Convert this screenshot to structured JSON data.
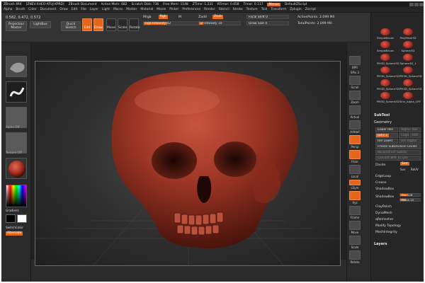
{
  "titlebar": {
    "app": "ZBrush 4R4",
    "file": "[ZNEV-XHEO-ATUJ-XPRD]",
    "doc": "ZBrush Document",
    "active_mem": "Active Mem: 682",
    "scratch": "Scratch Disk: 736",
    "free_mem": "Free Mem: 1148",
    "ztime": "ZTime: 1.231",
    "rtimer": "RTimer: 0.458",
    "timer": "Timer: 0.117",
    "menus_label": "Menus",
    "script": "DefaultZScript"
  },
  "menubar": [
    "Alpha",
    "Brush",
    "Color",
    "Document",
    "Draw",
    "Edit",
    "File",
    "Layer",
    "Light",
    "Macro",
    "Marker",
    "Material",
    "Movie",
    "Picker",
    "Preferences",
    "Render",
    "Stencil",
    "Stroke",
    "Texture",
    "Tool",
    "Transform",
    "Zplugin",
    "Zscript"
  ],
  "toolbar": {
    "coords": "0.582, 0.472, 0.572",
    "projection_master": "Projection Master",
    "lightbox": "LightBox",
    "quick_sketch": "Quick Sketch",
    "edit": "Edit",
    "draw": "Draw",
    "move": "Move",
    "scale": "Scale",
    "rotate": "Rotate",
    "mrgb": "Mrgb",
    "rgb": "Rgb",
    "m": "M",
    "rgb_intensity": "Rgb Intensity 42",
    "rgb_intensity_value": 42,
    "zadd": "Zadd",
    "zsub": "Zsub",
    "z_intensity": "Z Intensity 10",
    "z_intensity_value": 10,
    "focal_shift": "Focal Shift 0",
    "draw_size": "Draw Size 4",
    "active_points": "ActivePoints: 2.099 Mil",
    "total_points": "TotalPoints: 2.099 Mil"
  },
  "leftshelf": {
    "alpha_off": "Alpha Off",
    "texture_off": "Texture Off",
    "gradient": "Gradient",
    "switch_color": "SwitchColor",
    "alternate": "Alternate"
  },
  "rightstrip": [
    "BPR",
    "SPix 3",
    "Scroll",
    "Zoom",
    "Actual",
    "AAHalf",
    "Persp",
    "Floor",
    "Local",
    "LSym",
    "Xyz",
    "Frame",
    "Move",
    "Scale",
    "Rotate"
  ],
  "palette": {
    "tools": [
      "SimpleBrush",
      "PolyMesh3D",
      "SimpleBrush",
      "Sphere3D",
      "PM3D_Sphere3D",
      "Sphere3D_1",
      "PM3D_Sphere3D",
      "PM3D_Sphere3D",
      "PM3D_Sphere3D",
      "PM3D_Sphere3D",
      "PM3D_Sphere3D",
      "Skin_Alpha_OFF"
    ],
    "subtool": "SubTool",
    "geometry": "Geometry",
    "lower_res": "Lower Res",
    "higher_res": "Higher Res",
    "sdiv": "SDiv 2",
    "cage": "Cage",
    "rstr": "Rstr",
    "del_lower": "Del Lower",
    "del_higher": "Del Higher",
    "freeze_subdiv": "Freeze SubDivision Levels",
    "reconstruct": "Reconstruct Subdiv",
    "convert_bpr": "Convert BPR To Geo",
    "divide": "Divide",
    "smt": "Smt",
    "suv": "Suv",
    "reuv": "ReUV",
    "edgeloop": "EdgeLoop",
    "crease": "Crease",
    "shadowbox": "ShadowBox",
    "shadowbox_btn": "ShadowBox",
    "res": "Res 128",
    "polish": "Polish 10",
    "claypolish": "ClayPolish",
    "dynamesh": "DynaMesh",
    "zremesher": "qRemesher",
    "modify_topology": "Modify Topology",
    "meshintegrity": "MeshIntegrity",
    "layers": "Layers"
  },
  "accent": "#e4661b",
  "skin_color": "#a63a2a"
}
